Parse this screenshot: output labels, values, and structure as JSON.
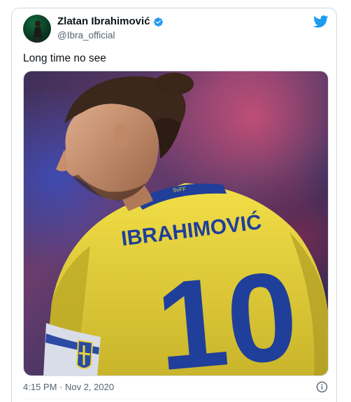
{
  "tweet": {
    "author": {
      "display_name": "Zlatan Ibrahimović",
      "handle": "@Ibra_official",
      "verified": true
    },
    "text": "Long time no see",
    "timestamp": "4:15 PM · Nov 2, 2020",
    "media": {
      "jersey_name": "IBRAHIMOVIĆ",
      "jersey_number": "10",
      "collar_text": "SvFF"
    }
  },
  "icons": {
    "twitter": "twitter-bird-icon",
    "verified": "verified-badge-icon",
    "info": "info-icon"
  },
  "colors": {
    "twitter_blue": "#1d9bf0",
    "jersey_yellow": "#e9d63c",
    "jersey_blue": "#1f3f9a"
  }
}
